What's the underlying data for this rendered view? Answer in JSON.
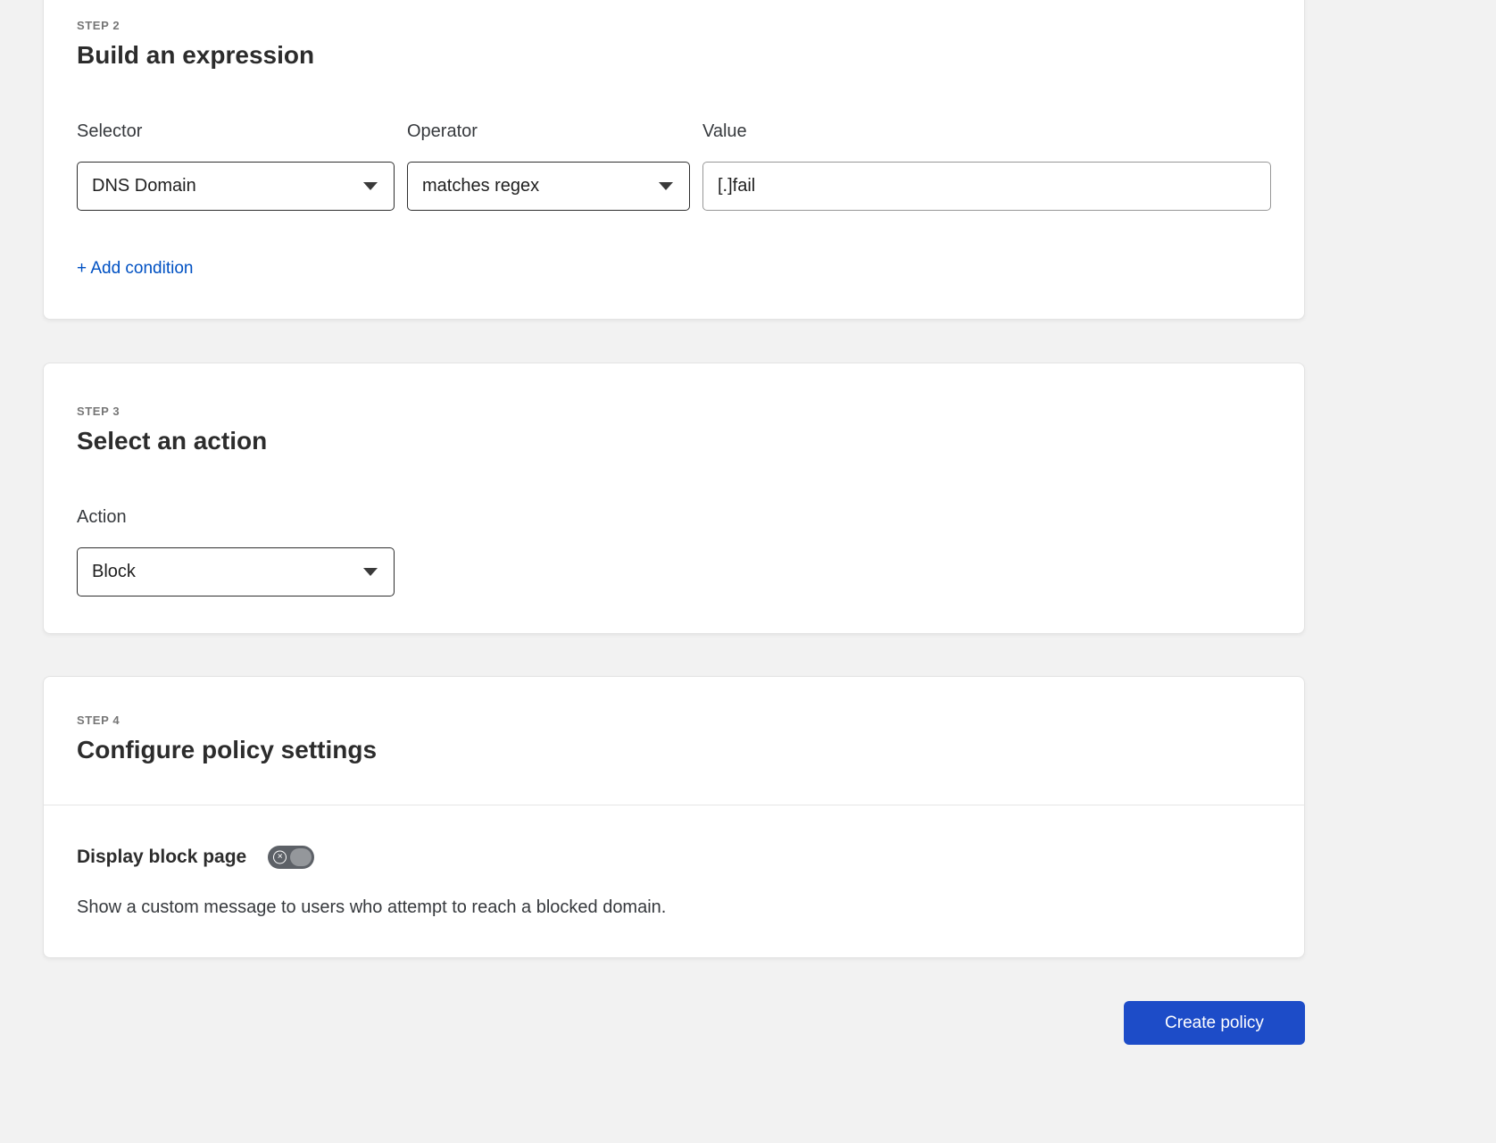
{
  "steps": {
    "step2": {
      "eyebrow": "STEP 2",
      "title": "Build an expression",
      "selector": {
        "label": "Selector",
        "value": "DNS Domain"
      },
      "operator": {
        "label": "Operator",
        "value": "matches regex"
      },
      "value": {
        "label": "Value",
        "text": "[.]fail"
      },
      "add_condition": "+ Add condition"
    },
    "step3": {
      "eyebrow": "STEP 3",
      "title": "Select an action",
      "action": {
        "label": "Action",
        "value": "Block"
      }
    },
    "step4": {
      "eyebrow": "STEP 4",
      "title": "Configure policy settings",
      "display_block_page": {
        "label": "Display block page",
        "toggle_state": "off",
        "description": "Show a custom message to users who attempt to reach a blocked domain."
      }
    }
  },
  "footer": {
    "create_policy": "Create policy"
  },
  "colors": {
    "accent_blue": "#0051c3",
    "button_blue": "#1d4cc8",
    "toggle_off_gray": "#5d6167",
    "page_background": "#f2f2f2"
  }
}
